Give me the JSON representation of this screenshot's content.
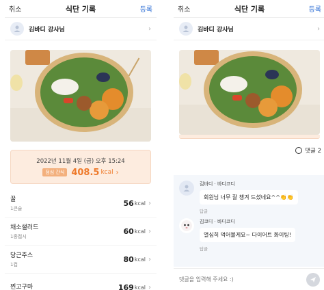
{
  "colors": {
    "accent": "#2f6fd6",
    "calorie": "#ee7a2b",
    "meal_box_bg": "#fdecdf",
    "comment_bg": "#f4f7fb"
  },
  "left": {
    "nav": {
      "cancel": "취소",
      "title": "식단 기록",
      "done": "등록"
    },
    "author": {
      "name": "김바디 강사님",
      "icon": "user-icon"
    },
    "meal": {
      "datetime": "2022년 11월 4일 (금) 오후 15:24",
      "badge": "점심 간식",
      "kcal": "408.5",
      "unit": "kcal"
    },
    "foods": [
      {
        "name": "꿀",
        "amount": "1큰술",
        "kcal": "56",
        "unit": "kcal"
      },
      {
        "name": "채소샐러드",
        "amount": "1종접시",
        "kcal": "60",
        "unit": "kcal"
      },
      {
        "name": "당근주스",
        "amount": "1컵",
        "kcal": "80",
        "unit": "kcal"
      },
      {
        "name": "찐고구마",
        "amount": "",
        "kcal": "169",
        "unit": "kcal"
      }
    ]
  },
  "right": {
    "nav": {
      "cancel": "취소",
      "title": "식단 기록",
      "done": "등록"
    },
    "author": {
      "name": "김바디 강사님",
      "icon": "user-icon"
    },
    "comment_count": "댓글 2",
    "comments": [
      {
        "author": "김바디 · 바디코디",
        "text": "회원님 너무 잘 챙겨 드셨네요^^👏👏",
        "reply": "답글"
      },
      {
        "author": "김코디 · 바디코디",
        "text": "열심히 먹어볼게요~ 다이어트 화이팅!",
        "reply": "답글"
      }
    ],
    "input": {
      "placeholder": "댓글을 입력해 주세요 :)"
    }
  }
}
